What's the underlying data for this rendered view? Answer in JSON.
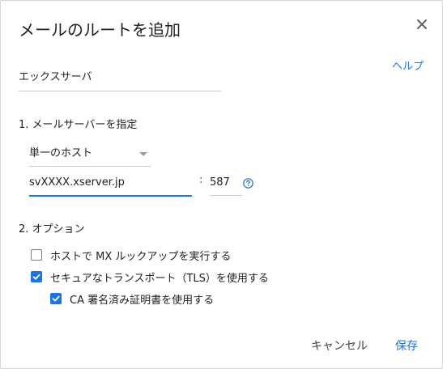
{
  "dialog": {
    "title": "メールのルートを追加",
    "help_label": "ヘルプ",
    "close_icon": "close-icon"
  },
  "route_name": {
    "value": "エックスサーバ"
  },
  "server_section": {
    "title": "1. メールサーバーを指定",
    "host_type_selected": "単一のホスト",
    "server_value": "svXXXX.xserver.jp",
    "separator": ":",
    "port_value": "587",
    "help_icon": "question-circle-icon"
  },
  "options_section": {
    "title": "2. オプション",
    "items": [
      {
        "label": "ホストで MX ルックアップを実行する",
        "checked": false
      },
      {
        "label": "セキュアなトランスポート（TLS）を使用する",
        "checked": true
      },
      {
        "label": "CA 署名済み証明書を使用する",
        "checked": true
      }
    ]
  },
  "footer": {
    "cancel_label": "キャンセル",
    "save_label": "保存"
  },
  "colors": {
    "accent": "#1a73e8",
    "text": "#202124",
    "border": "#c8c8c8"
  }
}
